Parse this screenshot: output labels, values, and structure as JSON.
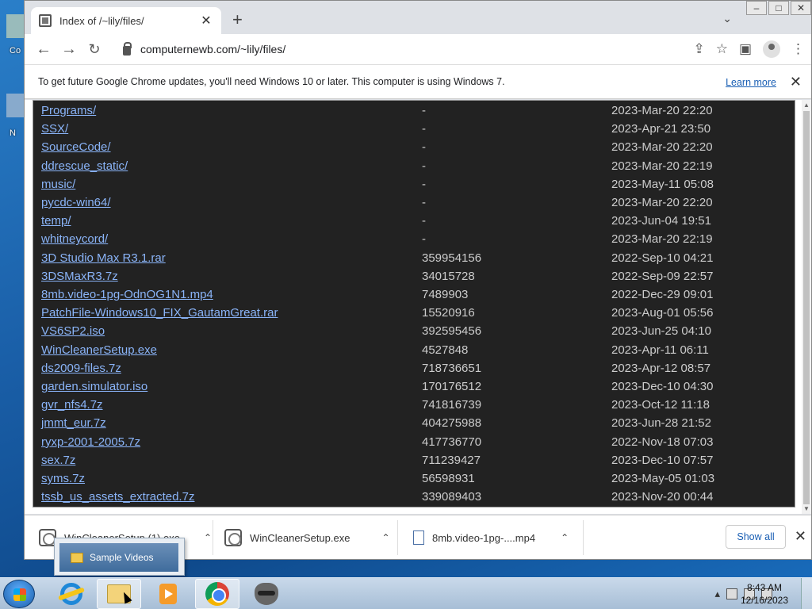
{
  "desktop": {
    "icon_label_1": "Co",
    "icon_label_2": "N"
  },
  "browser": {
    "tab_title": "Index of /~lily/files/",
    "url": "computernewb.com/~lily/files/"
  },
  "infobar": {
    "message": "To get future Google Chrome updates, you'll need Windows 10 or later. This computer is using Windows 7.",
    "learn_more": "Learn more"
  },
  "listing": [
    {
      "name": "Programs/",
      "size": "-",
      "date": "2023-Mar-20 22:20"
    },
    {
      "name": "SSX/",
      "size": "-",
      "date": "2023-Apr-21 23:50"
    },
    {
      "name": "SourceCode/",
      "size": "-",
      "date": "2023-Mar-20 22:20"
    },
    {
      "name": "ddrescue_static/",
      "size": "-",
      "date": "2023-Mar-20 22:19"
    },
    {
      "name": "music/",
      "size": "-",
      "date": "2023-May-11 05:08"
    },
    {
      "name": "pycdc-win64/",
      "size": "-",
      "date": "2023-Mar-20 22:20"
    },
    {
      "name": "temp/",
      "size": "-",
      "date": "2023-Jun-04 19:51"
    },
    {
      "name": "whitneycord/",
      "size": "-",
      "date": "2023-Mar-20 22:19"
    },
    {
      "name": "3D Studio Max R3.1.rar",
      "size": "359954156",
      "date": "2022-Sep-10 04:21"
    },
    {
      "name": "3DSMaxR3.7z",
      "size": "34015728",
      "date": "2022-Sep-09 22:57"
    },
    {
      "name": "8mb.video-1pg-OdnOG1N1.mp4",
      "size": "7489903",
      "date": "2022-Dec-29 09:01"
    },
    {
      "name": "PatchFile-Windows10_FIX_GautamGreat.rar",
      "size": "15520916",
      "date": "2023-Aug-01 05:56"
    },
    {
      "name": "VS6SP2.iso",
      "size": "392595456",
      "date": "2023-Jun-25 04:10"
    },
    {
      "name": "WinCleanerSetup.exe",
      "size": "4527848",
      "date": "2023-Apr-11 06:11"
    },
    {
      "name": "ds2009-files.7z",
      "size": "718736651",
      "date": "2023-Apr-12 08:57"
    },
    {
      "name": "garden.simulator.iso",
      "size": "170176512",
      "date": "2023-Dec-10 04:30"
    },
    {
      "name": "gvr_nfs4.7z",
      "size": "741816739",
      "date": "2023-Oct-12 11:18"
    },
    {
      "name": "jmmt_eur.7z",
      "size": "404275988",
      "date": "2023-Jun-28 21:52"
    },
    {
      "name": "ryxp-2001-2005.7z",
      "size": "417736770",
      "date": "2022-Nov-18 07:03"
    },
    {
      "name": "sex.7z",
      "size": "711239427",
      "date": "2023-Dec-10 07:57"
    },
    {
      "name": "syms.7z",
      "size": "56598931",
      "date": "2023-May-05 01:03"
    },
    {
      "name": "tssb_us_assets_extracted.7z",
      "size": "339089403",
      "date": "2023-Nov-20 00:44"
    }
  ],
  "downloads": {
    "items": [
      "WinCleanerSetup (1).exe",
      "WinCleanerSetup.exe",
      "8mb.video-1pg-....mp4"
    ],
    "show_all": "Show all"
  },
  "tooltip": {
    "label": "Sample Videos"
  },
  "taskbar": {
    "time": "8:43 AM",
    "date": "12/16/2023"
  },
  "colors": {
    "link": "#8ab4f8",
    "listing_bg": "#222222",
    "accent": "#1a5fb4"
  }
}
